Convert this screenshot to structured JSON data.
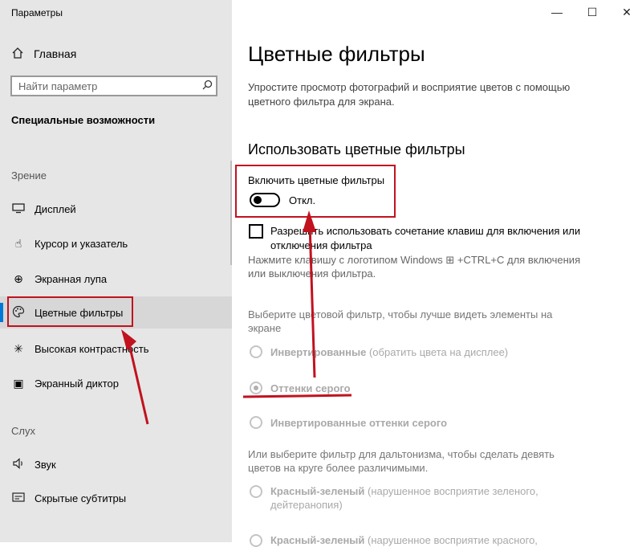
{
  "window": {
    "title": "Параметры",
    "controls": {
      "minimize": "—",
      "maximize": "☐",
      "close": "✕"
    }
  },
  "sidebar": {
    "home": {
      "icon": "home-icon",
      "label": "Главная"
    },
    "search": {
      "placeholder": "Найти параметр",
      "icon": "search-icon"
    },
    "section_title": "Специальные возможности",
    "groups": [
      {
        "label": "Зрение"
      },
      {
        "label": "Слух"
      }
    ],
    "items": [
      {
        "icon": "display-icon",
        "glyph": "▭",
        "label": "Дисплей"
      },
      {
        "icon": "cursor-icon",
        "glyph": "☝",
        "label": "Курсор и указатель"
      },
      {
        "icon": "magnifier-icon",
        "glyph": "⊕",
        "label": "Экранная лупа"
      },
      {
        "icon": "palette-icon",
        "glyph": "◔",
        "label": "Цветные фильтры",
        "active": true
      },
      {
        "icon": "contrast-icon",
        "glyph": "✳",
        "label": "Высокая контрастность"
      },
      {
        "icon": "narrator-icon",
        "glyph": "▣",
        "label": "Экранный диктор"
      },
      {
        "icon": "audio-icon",
        "glyph": "🔈",
        "label": "Звук"
      },
      {
        "icon": "captions-icon",
        "glyph": "▤",
        "label": "Скрытые субтитры"
      }
    ]
  },
  "main": {
    "title": "Цветные фильтры",
    "description": "Упростите просмотр фотографий и восприятие цветов с помощью цветного фильтра для экрана.",
    "subheading": "Использовать цветные фильтры",
    "toggle": {
      "label": "Включить цветные фильтры",
      "state": "Откл.",
      "on": false
    },
    "shortcut_checkbox": {
      "label": "Разрешить использовать сочетание клавиш для включения или отключения фильтра",
      "checked": false
    },
    "shortcut_hint": "Нажмите клавишу с логотипом Windows ⊞ +CTRL+C для включения или выключения фильтра.",
    "choose_text": "Выберите цветовой фильтр, чтобы лучше видеть элементы на экране",
    "filters": [
      {
        "label": "Инвертированные",
        "note": "(обратить цвета на дисплее)",
        "checked": false
      },
      {
        "label": "Оттенки серого",
        "note": "",
        "checked": true
      },
      {
        "label": "Инвертированные оттенки серого",
        "note": "",
        "checked": false
      }
    ],
    "colorblind_text": "Или выберите фильтр для дальтонизма, чтобы сделать девять цветов на круге более различимыми.",
    "colorblind_filters": [
      {
        "label": "Красный-зеленый",
        "note": "(нарушенное восприятие зеленого, дейтеранопия)",
        "checked": false
      },
      {
        "label": "Красный-зеленый",
        "note": "(нарушенное восприятие красного,",
        "checked": false
      }
    ]
  },
  "annotations": {
    "color": "#c1121f"
  }
}
